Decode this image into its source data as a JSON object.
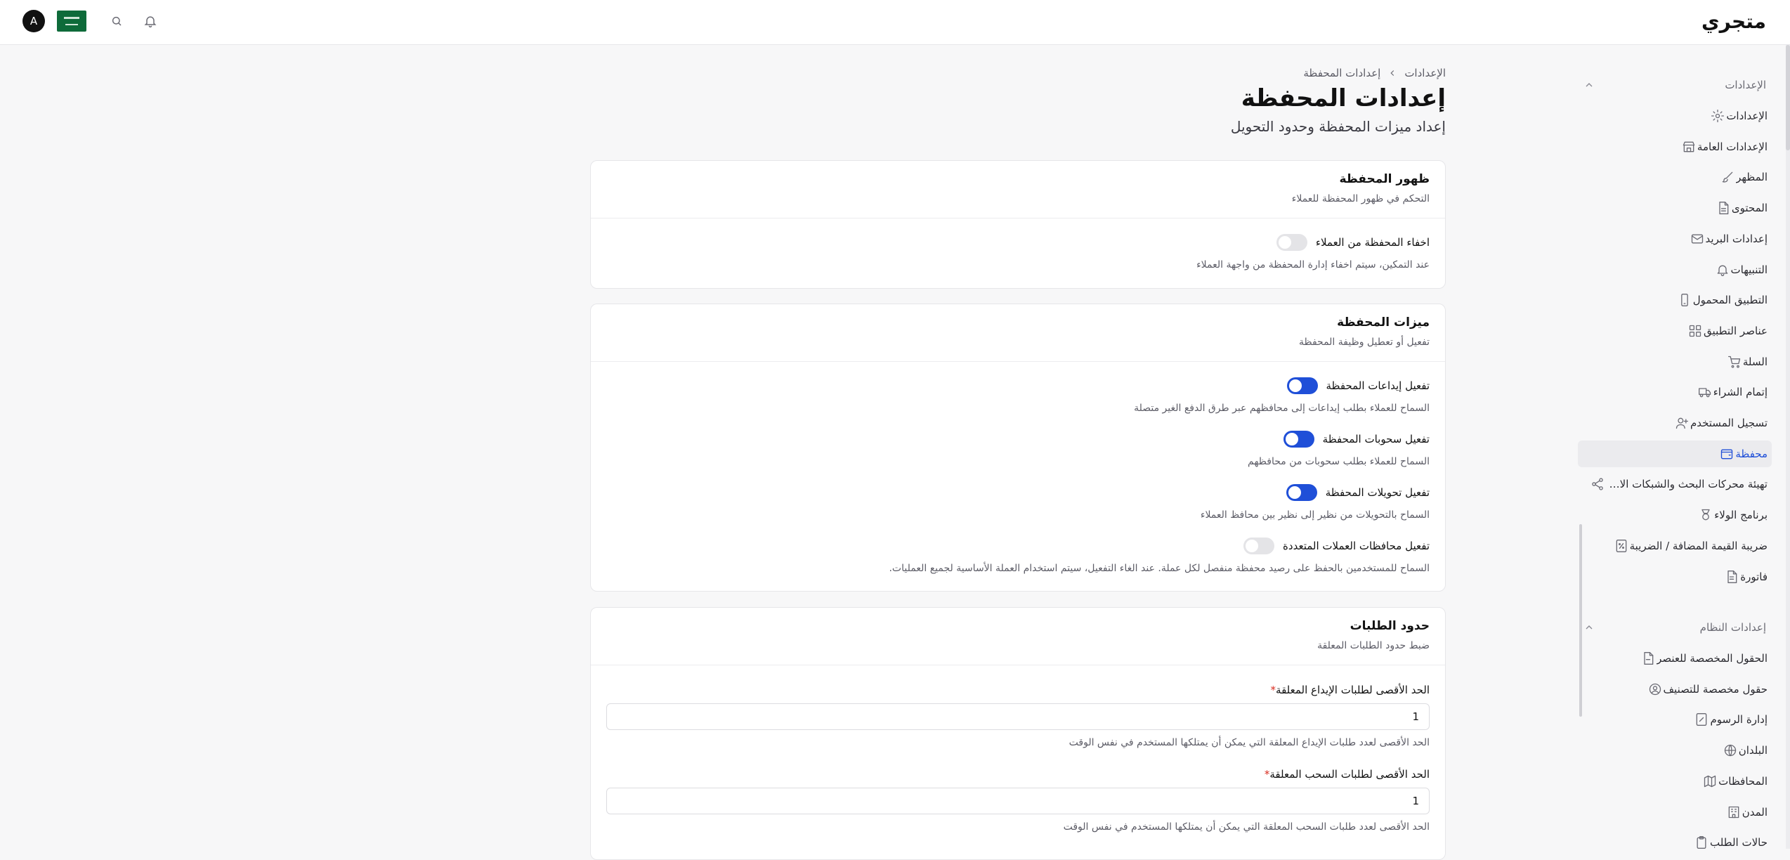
{
  "header": {
    "brand": "متجري",
    "avatar_letter": "A"
  },
  "sidebar": {
    "settings_section": "الإعدادات",
    "items": [
      {
        "label": "الإعدادات",
        "icon": "gear-icon"
      },
      {
        "label": "الإعدادات العامة",
        "icon": "store-icon"
      },
      {
        "label": "المظهر",
        "icon": "brush-icon"
      },
      {
        "label": "المحتوى",
        "icon": "document-icon"
      },
      {
        "label": "إعدادات البريد",
        "icon": "mail-icon"
      },
      {
        "label": "التنبيهات",
        "icon": "bell-icon"
      },
      {
        "label": "التطبيق المحمول",
        "icon": "smartphone-icon"
      },
      {
        "label": "عناصر التطبيق",
        "icon": "grid-icon"
      },
      {
        "label": "السلة",
        "icon": "cart-icon"
      },
      {
        "label": "إتمام الشراء",
        "icon": "truck-icon"
      },
      {
        "label": "تسجيل المستخدم",
        "icon": "user-plus-icon"
      },
      {
        "label": "محفظة",
        "icon": "wallet-icon"
      },
      {
        "label": "تهيئة محركات البحث والشبكات الاجتماعية",
        "icon": "share-icon"
      },
      {
        "label": "برنامج الولاء",
        "icon": "award-icon"
      },
      {
        "label": "ضريبة القيمة المضافة / الضريبة",
        "icon": "percent-icon"
      },
      {
        "label": "فاتورة",
        "icon": "invoice-icon"
      }
    ],
    "system_section": "إعدادات النظام",
    "system_items": [
      {
        "label": "الحقول المخصصة للعنصر",
        "icon": "file-fields-icon"
      },
      {
        "label": "حقول مخصصة للتصنيف",
        "icon": "user-circle-icon"
      },
      {
        "label": "إدارة الرسوم",
        "icon": "fees-icon"
      },
      {
        "label": "البلدان",
        "icon": "globe-icon"
      },
      {
        "label": "المحافظات",
        "icon": "map-icon"
      },
      {
        "label": "المدن",
        "icon": "building-icon"
      },
      {
        "label": "حالات الطلب",
        "icon": "clipboard-icon"
      }
    ]
  },
  "breadcrumb": {
    "root": "الإعدادات",
    "current": "إعدادات المحفظة"
  },
  "page": {
    "title": "إعدادات المحفظة",
    "subtitle": "إعداد ميزات المحفظة وحدود التحويل"
  },
  "visibility_card": {
    "title": "ظهور المحفظة",
    "desc": "التحكم في ظهور المحفظة للعملاء",
    "toggle_label": "اخفاء المحفظة من العملاء",
    "toggle_desc": "عند التمكين، سيتم اخفاء إدارة المحفظة من واجهة العملاء",
    "toggle_on": false
  },
  "features_card": {
    "title": "ميزات المحفظة",
    "desc": "تفعيل أو تعطيل وظيفة المحفظة",
    "toggles": [
      {
        "label": "تفعيل إيداعات المحفظة",
        "desc": "السماح للعملاء بطلب إيداعات إلى محافظهم عبر طرق الدفع الغير متصلة",
        "on": true
      },
      {
        "label": "تفعيل سحوبات المحفظة",
        "desc": "السماح للعملاء بطلب سحوبات من محافظهم",
        "on": true
      },
      {
        "label": "تفعيل تحويلات المحفظة",
        "desc": "السماح بالتحويلات من نظير إلى نظير بين محافظ العملاء",
        "on": true
      },
      {
        "label": "تفعيل محافظات العملات المتعددة",
        "desc": "السماح للمستخدمين بالحفظ على رصيد محفظة منفصل لكل عملة. عند الغاء التفعيل، سيتم استخدام العملة الأساسية لجميع العمليات.",
        "on": false
      }
    ]
  },
  "limits_card": {
    "title": "حدود الطلبات",
    "desc": "ضبط حدود الطلبات المعلقة",
    "fields": [
      {
        "label": "الحد الأقصى لطلبات الإيداع المعلقة",
        "value": "1",
        "help": "الحد الأقصى لعدد طلبات الإيداع المعلقة التي يمكن أن يمتلكها المستخدم في نفس الوقت"
      },
      {
        "label": "الحد الأقصى لطلبات السحب المعلقة",
        "value": "1",
        "help": "الحد الأقصى لعدد طلبات السحب المعلقة التي يمكن أن يمتلكها المستخدم في نفس الوقت"
      }
    ],
    "required_mark": "*"
  },
  "colors": {
    "accent": "#1f4fd8",
    "flag_green": "#0e6b3a"
  }
}
